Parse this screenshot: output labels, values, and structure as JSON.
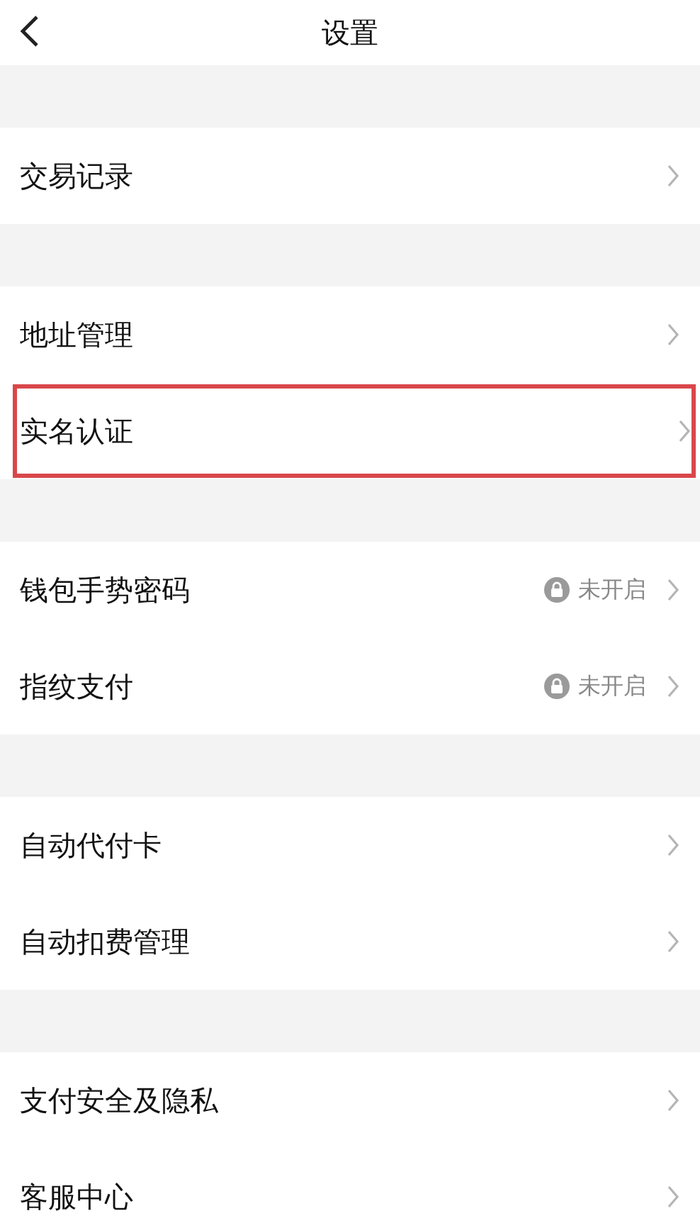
{
  "header": {
    "title": "设置"
  },
  "groups": [
    {
      "items": [
        {
          "label": "交易记录",
          "highlighted": false
        }
      ]
    },
    {
      "items": [
        {
          "label": "地址管理",
          "highlighted": false
        },
        {
          "label": "实名认证",
          "highlighted": true
        }
      ]
    },
    {
      "items": [
        {
          "label": "钱包手势密码",
          "highlighted": false,
          "status": "未开启",
          "locked": true
        },
        {
          "label": "指纹支付",
          "highlighted": false,
          "status": "未开启",
          "locked": true
        }
      ]
    },
    {
      "items": [
        {
          "label": "自动代付卡",
          "highlighted": false
        },
        {
          "label": "自动扣费管理",
          "highlighted": false
        }
      ]
    },
    {
      "items": [
        {
          "label": "支付安全及隐私",
          "highlighted": false
        },
        {
          "label": "客服中心",
          "highlighted": false
        }
      ]
    }
  ]
}
